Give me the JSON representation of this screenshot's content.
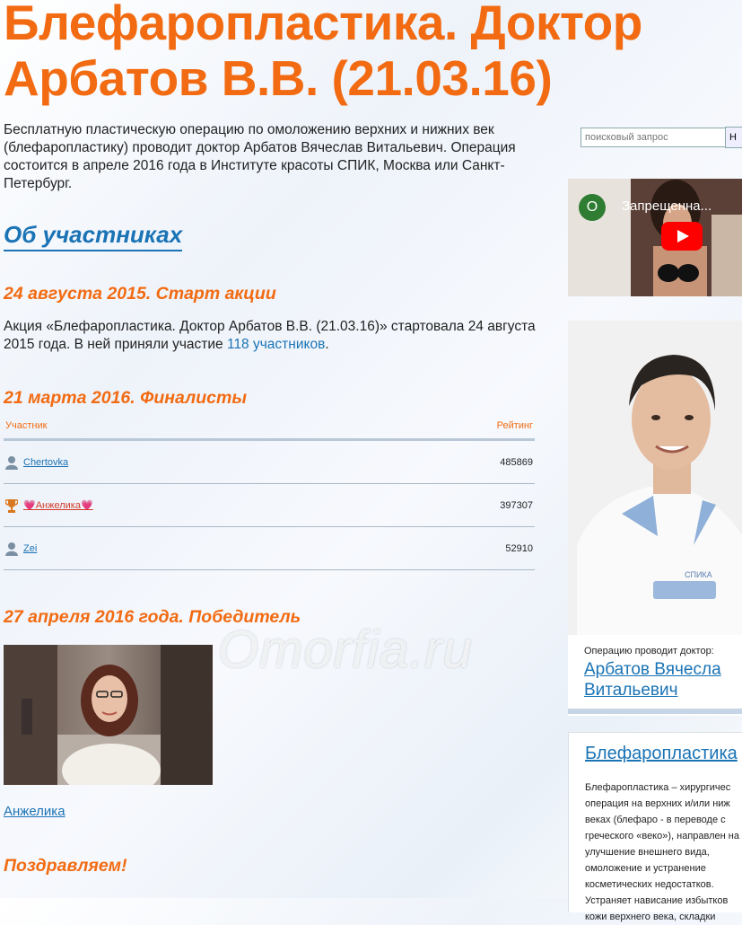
{
  "header": {
    "title": "Блефаропластика. Доктор Арбатов В.В. (21.03.16)"
  },
  "intro": {
    "text": " Бесплатную пластическую операцию по омоложению верхних и нижних век (блефаропластику) проводит доктор Арбатов Вячеслав Витальевич. Операция состоится в апреле 2016 года в Институте красоты СПИК, Москва или Санкт-Петербург."
  },
  "nav": {
    "members_label": "Об участниках"
  },
  "start": {
    "heading": "24 августа 2015. Старт акции",
    "text_before": "Акция «Блефаропластика. Доктор Арбатов В.В. (21.03.16)» стартовала 24 августа 2015 года. В ней приняли участие ",
    "link": "118 участников",
    "text_after": "."
  },
  "finalists": {
    "heading": "21 марта 2016. Финалисты",
    "col_participant": "Участник",
    "col_rating": "Рейтинг",
    "rows": [
      {
        "name": "Chertovka",
        "rating": "485869",
        "icon": "user-icon"
      },
      {
        "name": "💗Анжелика💗",
        "rating": "397307",
        "icon": "trophy-icon"
      },
      {
        "name": "Zei",
        "rating": "52910",
        "icon": "user-icon"
      }
    ]
  },
  "winner": {
    "heading": "27 апреля 2016 года. Победитель",
    "name": "Анжелика",
    "congrats": "Поздравляем!"
  },
  "watermark": {
    "text": "Omorfia.ru"
  },
  "sidebar": {
    "search_placeholder": "поисковый запрос",
    "search_button": "Н",
    "video": {
      "avatar_letter": "O",
      "title": "Запрещенна..."
    },
    "doctor": {
      "caption": "Операцию проводит доктор:",
      "name_line1": "Арбатов Вячесла",
      "name_line2": "Витальевич",
      "badge": "СПИКА"
    },
    "info": {
      "title": "Блефаропластика",
      "text": "Блефаропластика – хирургичес операция на верхних и/или ниж веках (блефаро - в переводе с греческого «веко»), направлен на улучшение внешнего вида, омоложение и устранение косметических недостатков. Устраняет нависание избытков кожи верхнего века, складки"
    }
  },
  "colors": {
    "accent_orange": "#f26b12",
    "link_blue": "#1a73b5"
  }
}
